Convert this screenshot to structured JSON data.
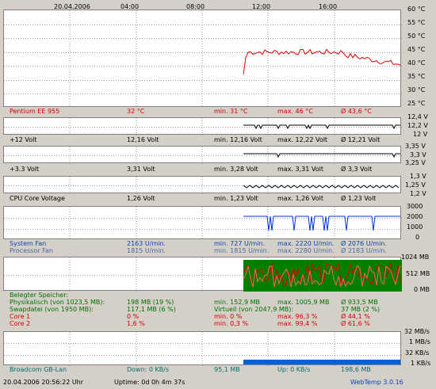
{
  "time_axis": {
    "date": "20.04.2006",
    "ticks": [
      "04:00",
      "08:00",
      "12:00",
      "16:00"
    ]
  },
  "temperature": {
    "right_ticks": [
      "60 °C",
      "55 °C",
      "50 °C",
      "45 °C",
      "40 °C",
      "35 °C",
      "30 °C",
      "25 °C"
    ],
    "label": "Pentium EE 955",
    "current": "32 °C",
    "min": "min. 31 °C",
    "max": "max. 46 °C",
    "avg": "Ø 43,6 °C"
  },
  "v12": {
    "right_ticks": [
      "12,4 V",
      "12,2 V",
      "12 V"
    ],
    "label": "+12 Volt",
    "current": "12,16 Volt",
    "min": "min. 12,16 Volt",
    "max": "max. 12,22 Volt",
    "avg": "Ø 12,21 Volt"
  },
  "v33": {
    "right_ticks": [
      "3,35 V",
      "3,3 V",
      "3,25 V"
    ],
    "label": "+3.3 Volt",
    "current": "3,31 Volt",
    "min": "min. 3,28 Volt",
    "max": "max. 3,31 Volt",
    "avg": "Ø 3,3 Volt"
  },
  "vcore": {
    "right_ticks": [
      "1,3 V",
      "1,25 V",
      "1,2 V"
    ],
    "label": "CPU Core Voltage",
    "current": "1,26 Volt",
    "min": "min. 1,23 Volt",
    "max": "max. 1,26 Volt",
    "avg": "Ø 1,23 Volt"
  },
  "fans": {
    "right_ticks": [
      "3000",
      "2000",
      "1000",
      "0"
    ],
    "rows": [
      {
        "label": "System Fan",
        "current": "2163 U/min.",
        "min": "min. 727 U/min.",
        "max": "max. 2220 U/min.",
        "avg": "Ø 2076 U/min."
      },
      {
        "label": "Processor Fan",
        "current": "1815 U/min.",
        "min": "min. 1815 U/min.",
        "max": "max. 2280 U/min.",
        "avg": "Ø 2183 U/min."
      }
    ]
  },
  "memory": {
    "right_ticks": [
      "1024 MB",
      "512 MB",
      "0 MB"
    ],
    "heading": "Belegter Speicher:",
    "rows": [
      {
        "label": "Physikalisch (von 1023,5 MB):",
        "current": "198 MB (19 %)",
        "min": "min. 152,9 MB",
        "max": "max. 1005,9 MB",
        "avg": "Ø 933,5 MB"
      },
      {
        "label": "Swapdatei (von 1950 MB):",
        "current": "117,1 MB (6 %)",
        "min": "Virtuell (von 2047,9 MB):",
        "max": "",
        "avg": "37 MB (2 %)"
      },
      {
        "label": "Core 1",
        "current": "0 %",
        "min": "min. 0 %",
        "max": "max. 96,3 %",
        "avg": "Ø 44,1 %"
      },
      {
        "label": "Core 2",
        "current": "1,6 %",
        "min": "min. 0,3 %",
        "max": "max. 99,4 %",
        "avg": "Ø 61,6 %"
      }
    ]
  },
  "network": {
    "right_ticks": [
      "32 MB/s",
      "1 MB/s",
      "32 KB/s",
      "1 KB/s"
    ],
    "label": "Broadcom GB-Lan",
    "down": "Down: 0 KB/s",
    "down_total": "95,1 MB",
    "up": "Up: 0 KB/s",
    "up_total": "198,6 MB"
  },
  "footer": {
    "datetime": "20.04.2006 20:56:22 Uhr",
    "uptime": "Uptime: 0d 0h 4m 37s",
    "version": "WebTemp 3.0.16"
  },
  "colors": {
    "temp_line": "#e00000",
    "volt_line": "#000000",
    "fan_line": "#0030e0",
    "mem_fill": "#008000",
    "cpu_line": "#e00000",
    "net_fill": "#0060e0"
  }
}
